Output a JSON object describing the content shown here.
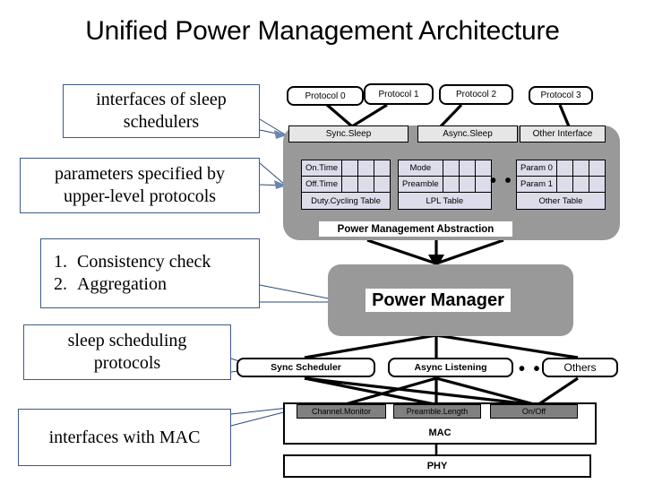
{
  "slide": {
    "title": "Unified Power Management Architecture"
  },
  "callouts": [
    {
      "id": "interfaces-of-sleep-schedulers",
      "line1": "interfaces of sleep",
      "line2": "schedulers"
    },
    {
      "id": "parameters-specified",
      "line1": "parameters specified by",
      "line2": "upper-level protocols"
    },
    {
      "id": "consistency-aggregation",
      "item1_num": "1.",
      "item1": "Consistency check",
      "item2_num": "2.",
      "item2": "Aggregation"
    },
    {
      "id": "sleep-scheduling-protocols",
      "line1": "sleep scheduling",
      "line2": "protocols"
    },
    {
      "id": "interfaces-with-mac",
      "line1": "interfaces with MAC"
    }
  ],
  "protocols": [
    {
      "label": "Protocol 0"
    },
    {
      "label": "Protocol 1"
    },
    {
      "label": "Protocol 2"
    },
    {
      "label": "Protocol 3"
    }
  ],
  "interfaces": [
    {
      "label": "Sync.Sleep"
    },
    {
      "label": "Async.Sleep"
    },
    {
      "label": "Other Interface"
    }
  ],
  "tables": [
    {
      "id": "dutycycling-table",
      "rows": [
        {
          "label": "On.Time"
        },
        {
          "label": "Off.Time"
        }
      ],
      "footer": "Duty.Cycling Table"
    },
    {
      "id": "lpl-table",
      "rows": [
        {
          "label": "Mode"
        },
        {
          "label": "Preamble"
        }
      ],
      "footer": "LPL Table"
    },
    {
      "id": "other-table",
      "rows": [
        {
          "label": "Param 0"
        },
        {
          "label": "Param 1"
        }
      ],
      "footer": "Other Table"
    }
  ],
  "ellipsis": "• • •",
  "banners": {
    "abstraction": "Power Management Abstraction",
    "manager": "Power Manager"
  },
  "schedulers": [
    {
      "label": "Sync Scheduler",
      "style": "bold"
    },
    {
      "label": "Async Listening",
      "style": "bold"
    },
    {
      "label": "Others",
      "style": "plain"
    }
  ],
  "mac_sublayers": [
    {
      "label": "Channel.Monitor"
    },
    {
      "label": "Preamble.Length"
    },
    {
      "label": "On/Off"
    }
  ],
  "stack": {
    "mac": "MAC",
    "phy": "PHY"
  },
  "colors": {
    "gray_container": "#999999",
    "interface_bar": "#e6e6e6",
    "table_cell": "#dcdcea",
    "mac_sublayer": "#808080",
    "callout_border": "#3d5a87",
    "connector": "#000000",
    "pointer_line": "#2a4a7c"
  }
}
